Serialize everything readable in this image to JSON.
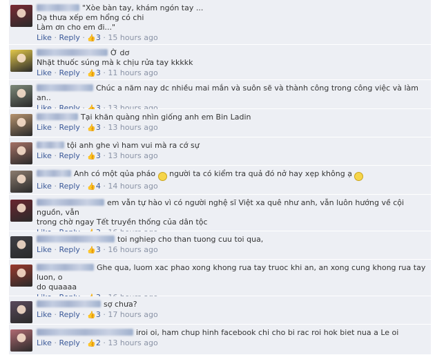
{
  "comments": [
    {
      "text": "\"Xòe bàn tay, khám ngón tay ...\nDạ thưa xếp em hổng có chi\nLàm ơn cho em đi...\"",
      "likes": "3",
      "time": "15 hours ago",
      "avatar_color": "#7b2a34"
    },
    {
      "text": "Ờ dơ\nNhặt thuốc súng mà k chịu rửa tay kkkkk",
      "likes": "3",
      "time": "11 hours ago",
      "avatar_color": "#e3c84a"
    },
    {
      "text": "Chúc a năm nay dc nhiều mai mắn và suôn sẽ và thành công trong công việc và làm an..",
      "likes": "3",
      "time": "13 hours ago",
      "avatar_color": "#7d8a7a"
    },
    {
      "text": "Tại khăn quàng nhìn giống anh em Bin Ladin",
      "likes": "3",
      "time": "13 hours ago",
      "avatar_color": "#b6936e"
    },
    {
      "text": "tội anh ghe vì ham vui mà ra cớ sự",
      "likes": "3",
      "time": "13 hours ago",
      "avatar_color": "#a57166"
    },
    {
      "text_a": "Anh có một qủa pháo ",
      "text_b": " người ta có kiểm tra quả đó nở hay xẹp không ạ ",
      "likes": "4",
      "time": "14 hours ago",
      "avatar_color": "#8c7c6f"
    },
    {
      "text": "em vẫn tự hào vì có người nghệ sĩ Việt xa quê như anh, vẫn luôn hướng về cội nguồn, vẫn\ntrong chờ ngay Tết truyền thống của dân tộc",
      "likes": "3",
      "time": "16 hours ago",
      "avatar_color": "#6a2630"
    },
    {
      "text": "toi nghiep cho than tuong cuu toi qua,",
      "likes": "3",
      "time": "16 hours ago",
      "avatar_color": "#3f3f45"
    },
    {
      "text": "Ghe qua, luom xac phao xong khong rua tay truoc khi an, an xong cung khong rua tay luon, o\ndo quaaaa",
      "likes": "3",
      "time": "16 hours ago",
      "avatar_color": "#9a3a2e"
    },
    {
      "text": "sợ chưa?",
      "likes": "3",
      "time": "17 hours ago",
      "avatar_color": "#5a4a5c"
    },
    {
      "text": "iroi oi, ham chup hinh facebook chi cho bi rac roi hok biet nua a Le oi",
      "likes": "2",
      "time": "13 hours ago",
      "avatar_color": "#b06a72"
    }
  ],
  "labels": {
    "like": "Like",
    "reply": "Reply",
    "sep": "·"
  }
}
